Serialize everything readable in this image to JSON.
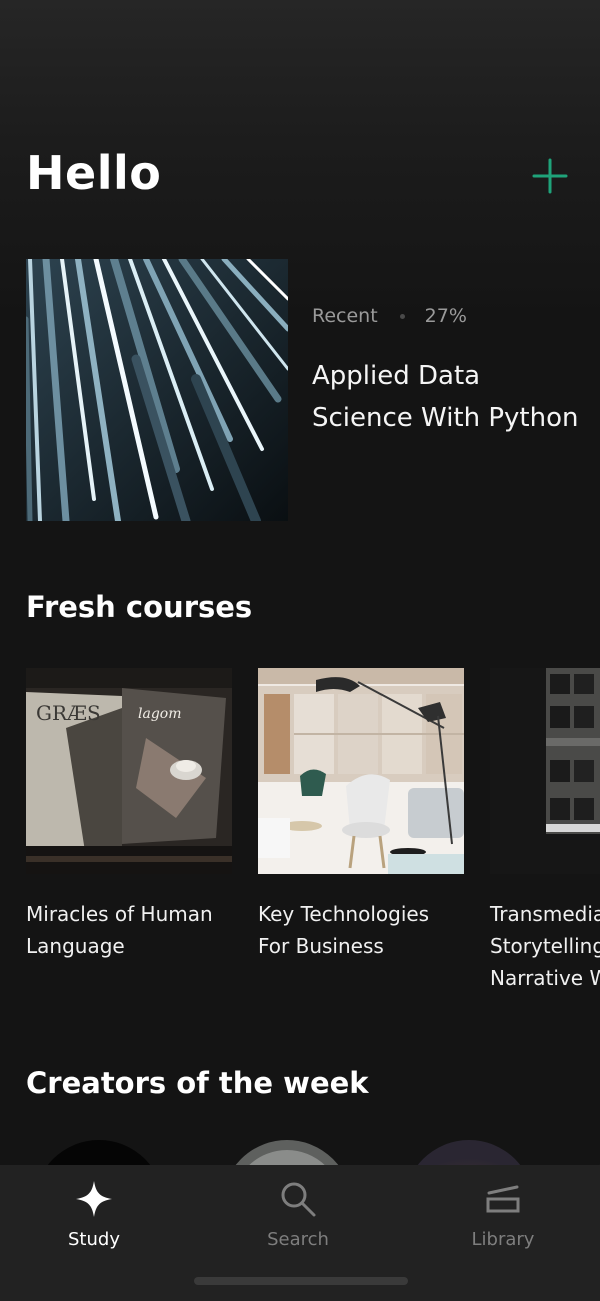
{
  "header": {
    "title": "Hello",
    "add_icon": "plus-icon"
  },
  "recent": {
    "label": "Recent",
    "progress": "27%",
    "title": "Applied Data Science With Python"
  },
  "fresh": {
    "title": "Fresh courses",
    "courses": [
      {
        "title_line1": "Miracles of Human",
        "title_line2": "Language",
        "title_line3": ""
      },
      {
        "title_line1": "Key Technologies",
        "title_line2": "For Business",
        "title_line3": ""
      },
      {
        "title_line1": "Transmedia",
        "title_line2": "Storytelling",
        "title_line3": "Narrative W"
      }
    ],
    "magazine_words": {
      "left": "GRÆS",
      "right": "lagom"
    }
  },
  "creators": {
    "title": "Creators of the week"
  },
  "tabs": [
    {
      "label": "Study",
      "icon": "sparkle-icon",
      "active": true
    },
    {
      "label": "Search",
      "icon": "search-icon",
      "active": false
    },
    {
      "label": "Library",
      "icon": "library-icon",
      "active": false
    }
  ],
  "colors": {
    "accent": "#1fa37a",
    "background": "#141414",
    "tab_bar": "#222222"
  }
}
